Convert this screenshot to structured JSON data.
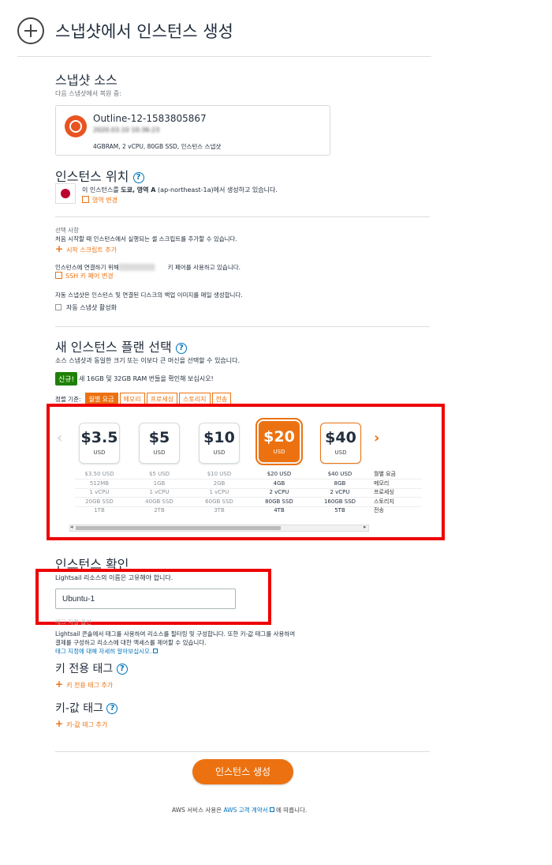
{
  "header": {
    "title": "스냅샷에서 인스턴스 생성"
  },
  "snapshot_source": {
    "title": "스냅샷 소스",
    "subtitle": "다음 스냅샷에서 복원 중:",
    "snapshot_name": "Outline-12-1583805867",
    "snapshot_id_blurred": "2020.03.10 10:36:23",
    "specs": "4GBRAM, 2 vCPU, 80GB SSD, 인스턴스 스냅샷"
  },
  "instance_location": {
    "title": "인스턴스 위치",
    "help": "?",
    "description_prefix": "이 인스턴스를 ",
    "location_bold": "도쿄, 영역 A",
    "location_code": " (ap-northeast-1a)",
    "description_suffix": "에서 생성하고 있습니다.",
    "change_link": "영역 변경"
  },
  "optional": {
    "label": "선택 사항",
    "script_desc": "처음 시작할 때 인스턴스에서 실행되는 셸 스크립트를 추가할 수 있습니다.",
    "script_link": "시작 스크립트 추가",
    "ssh_desc_prefix": "인스턴스에 연결하기 위해",
    "ssh_desc_suffix": "키 페어를 사용하고 있습니다.",
    "ssh_link": "SSH 키 페어 변경",
    "snapshot_desc": "자동 스냅샷은 인스턴스 및 연결된 디스크의 백업 이미지를 매일 생성합니다.",
    "auto_snapshot_label": "자동 스냅샷 활성화"
  },
  "plan": {
    "title": "새 인스턴스 플랜 선택",
    "help": "?",
    "desc": "소스 스냅샷과 동일한 크기 또는 이보다 큰 머신을 선택할 수 있습니다.",
    "badge": "신규!",
    "badge_text": "새 16GB 및 32GB RAM 번들을 확인해 보십시오!",
    "sort_label": "정렬 기준:",
    "sort_tabs": [
      "월별 요금",
      "메모리",
      "프로세싱",
      "스토리지",
      "전송"
    ],
    "cards": [
      {
        "amount": "$3.5",
        "currency": "USD"
      },
      {
        "amount": "$5",
        "currency": "USD"
      },
      {
        "amount": "$10",
        "currency": "USD"
      },
      {
        "amount": "$20",
        "currency": "USD"
      },
      {
        "amount": "$40",
        "currency": "USD"
      }
    ],
    "specs": [
      [
        "$3.50 USD",
        "512MB",
        "1 vCPU",
        "20GB SSD",
        "1TB"
      ],
      [
        "$5 USD",
        "1GB",
        "1 vCPU",
        "40GB SSD",
        "2TB"
      ],
      [
        "$10 USD",
        "2GB",
        "1 vCPU",
        "60GB SSD",
        "3TB"
      ],
      [
        "$20 USD",
        "4GB",
        "2 vCPU",
        "80GB SSD",
        "4TB"
      ],
      [
        "$40 USD",
        "8GB",
        "2 vCPU",
        "160GB SSD",
        "5TB"
      ]
    ],
    "spec_labels": [
      "월별 요금",
      "메모리",
      "프로세싱",
      "스토리지",
      "전송"
    ],
    "prev_icon": "‹",
    "next_icon": "›",
    "scroll_left": "◂",
    "scroll_right": "▸"
  },
  "confirm": {
    "title": "인스턴스 확인",
    "name_hint": "Lightsail 리소스의 이름은 고유해야 합니다.",
    "name_value": "Ubuntu-1",
    "tag_section_label": "태그 지정 옵션",
    "tag_desc_1": "Lightsail 콘솔에서 태그를 사용하여 리소스를 필터링 및 구성합니다. 또한 키-값 태그를 사용하여",
    "tag_desc_2": "결제를 구성하고 리소스에 대한 액세스를 제어할 수 있습니다.",
    "tag_learn_link": "태그 지정에 대해 자세히 알아보십시오.",
    "key_tag_title": "키 전용 태그",
    "key_tag_add": "키 전용 태그 추가",
    "kv_tag_title": "키-값 태그",
    "kv_tag_add": "키-값 태그 추가"
  },
  "footer": {
    "create_button": "인스턴스 생성",
    "terms_prefix": "AWS 서비스 사용은 ",
    "terms_link": "AWS 고객 계약서",
    "terms_suffix": " 에 따릅니다."
  }
}
